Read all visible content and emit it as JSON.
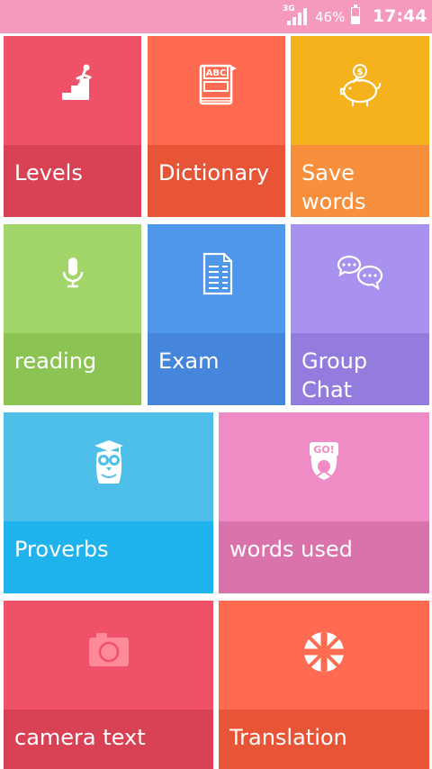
{
  "status_bar": {
    "network": "3G",
    "battery": "46%",
    "battery_level": 0.46,
    "time": "17:44"
  },
  "tiles": [
    {
      "label": "Levels",
      "icon": "stairs-climb-icon",
      "colors": {
        "top": "#ef5268",
        "bottom": "#d94254"
      }
    },
    {
      "label": "Dictionary",
      "icon": "book-abc-icon",
      "colors": {
        "top": "#ff6b51",
        "bottom": "#e85536"
      }
    },
    {
      "label": "Save words",
      "icon": "piggy-bank-icon",
      "colors": {
        "top": "#f6b21c",
        "bottom": "#f78f3c"
      }
    },
    {
      "label": "reading",
      "icon": "microphone-icon",
      "colors": {
        "top": "#a2d66b",
        "bottom": "#8bc453"
      }
    },
    {
      "label": "Exam",
      "icon": "document-list-icon",
      "colors": {
        "top": "#4e97ea",
        "bottom": "#4585db"
      }
    },
    {
      "label": "Group Chat",
      "icon": "chat-bubbles-icon",
      "colors": {
        "top": "#a891ef",
        "bottom": "#937cde"
      }
    },
    {
      "label": "Proverbs",
      "icon": "owl-graduate-icon",
      "colors": {
        "top": "#4dbfe8",
        "bottom": "#1eb3ec"
      }
    },
    {
      "label": "words used",
      "icon": "go-sign-icon",
      "colors": {
        "top": "#ef8bc5",
        "bottom": "#da72ac"
      }
    },
    {
      "label": "camera text",
      "icon": "camera-icon",
      "colors": {
        "top": "#ef5268",
        "bottom": "#d94254"
      }
    },
    {
      "label": "Translation",
      "icon": "union-flag-icon",
      "colors": {
        "top": "#ff6b51",
        "bottom": "#e85536"
      }
    }
  ]
}
